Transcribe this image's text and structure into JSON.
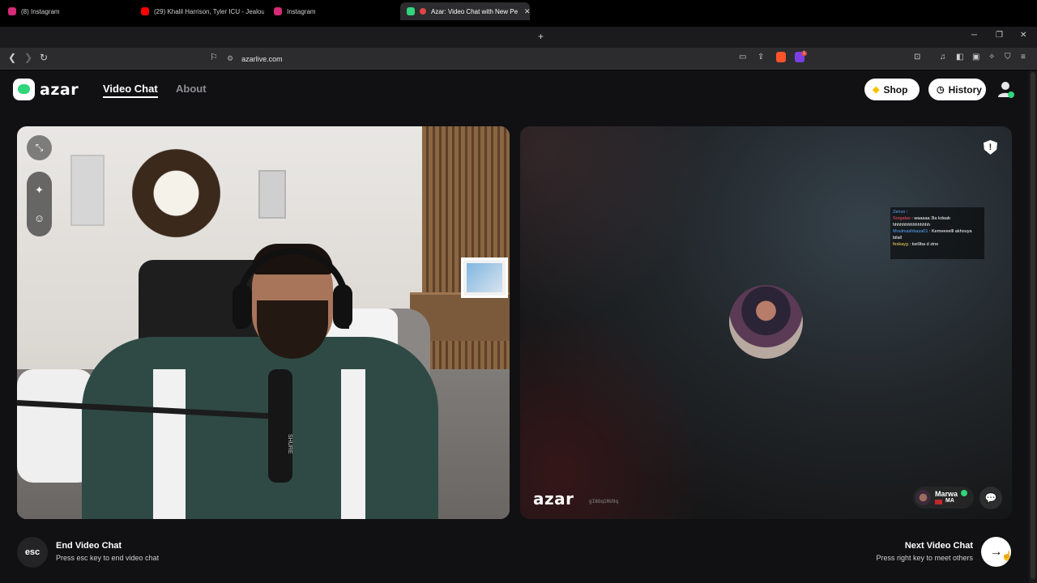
{
  "browser": {
    "tabs": [
      {
        "label": "(8) Instagram",
        "favicon_color": "#d62976"
      },
      {
        "label": "(29) Khalil Harrison, Tyler ICU - Jealou",
        "favicon_color": "#ff0000"
      },
      {
        "label": "Instagram",
        "favicon_color": "#d62976"
      },
      {
        "label": "Azar: Video Chat with New Pe",
        "favicon_color": "#2fd67b",
        "active": true
      }
    ],
    "new_tab": "+",
    "url": "azarlive.com",
    "shields_badge": "1"
  },
  "header": {
    "logo_text": "azar",
    "nav": {
      "video_chat": "Video Chat",
      "about": "About"
    },
    "shop_label": "Shop",
    "history_label": "History",
    "shop_icon": "gem-icon",
    "history_icon": "clock-icon"
  },
  "left_video": {
    "mic_brand": "SHURE"
  },
  "right_video": {
    "stream_chat": [
      {
        "user": "Zenvo",
        "text": ""
      },
      {
        "user": "Sorgalas",
        "text": "waaaaa 3la kdaab hhhhhhhhhhhhhhh"
      },
      {
        "user": "Moulmashbaza01",
        "text": "Kemeeeelll akhouya bilall"
      },
      {
        "user": "feskayg",
        "text": "tse9ba d zine"
      }
    ],
    "watermark_logo": "azar",
    "watermark_id": "gI8Oq1RU9q",
    "peer": {
      "name": "Marwa",
      "country": "MA"
    }
  },
  "footer": {
    "esc_label": "esc",
    "end_title": "End Video Chat",
    "end_sub": "Press esc key to end video chat",
    "next_title": "Next Video Chat",
    "next_sub": "Press right key to meet others",
    "next_icon": "arrow-right-icon"
  },
  "colors": {
    "brand_green": "#2fd67b",
    "page_bg": "#111113",
    "accent_red": "#c1272d"
  }
}
